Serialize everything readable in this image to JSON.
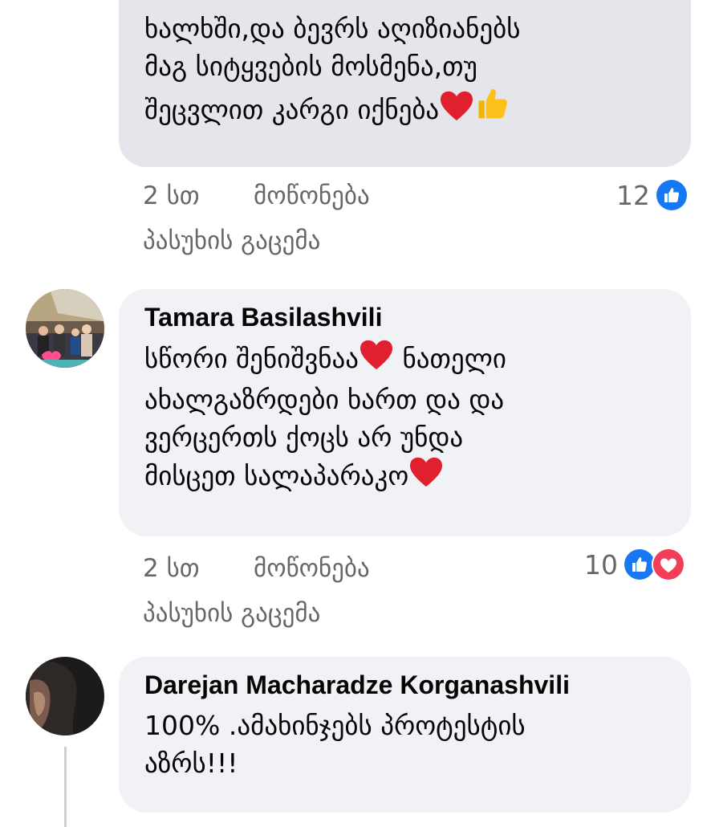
{
  "comments": [
    {
      "text": "ხალხში,და ბევრს აღიზიანებს\nმაგ სიტყვების მოსმენა,თუ\nშეცვლით კარგი იქნება",
      "time": "2 სთ",
      "like_label": "მოწონება",
      "reply_label": "პასუხის გაცემა",
      "reaction_count": "12",
      "reaction_icons": [
        "like-icon"
      ]
    },
    {
      "author": "Tamara Basilashvili",
      "text_lines": [
        "სწორი შენიშვნაა",
        " ნათელი",
        "ახალგაზრდები ხართ და და",
        "ვერცერთს ქოცს არ უნდა",
        "მისცეთ სალაპარაკო"
      ],
      "time": "2 სთ",
      "like_label": "მოწონება",
      "reply_label": "პასუხის გაცემა",
      "reaction_count": "10",
      "reaction_icons": [
        "like-icon",
        "love-icon"
      ]
    },
    {
      "author": "Darejan Macharadze Korganashvili",
      "text": "100% .ამახინჯებს პროტესტის\nაზრს!!!"
    }
  ],
  "colors": {
    "bubble": "#f0f2f5",
    "bubble_first": "#e4e6eb",
    "meta_text": "#65676b",
    "like_blue": "#1877f2",
    "love_red": "#f33e58"
  }
}
